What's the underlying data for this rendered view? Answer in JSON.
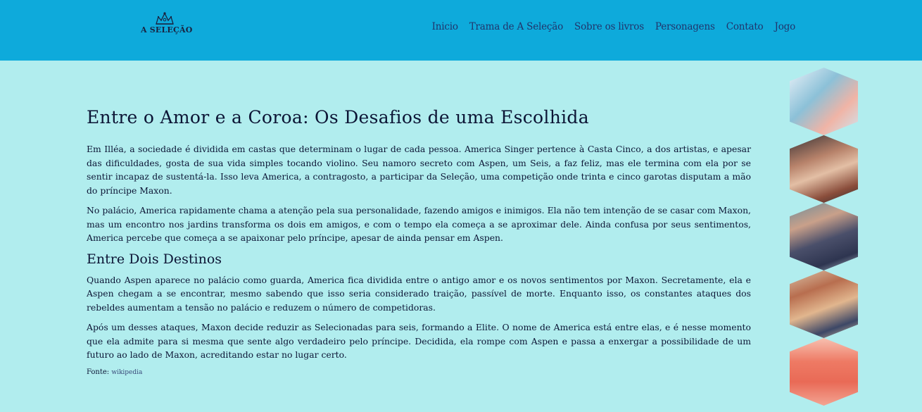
{
  "header": {
    "logo_text": "A SELEÇÃO",
    "logo_icon": "tiara-icon",
    "nav": [
      {
        "label": "Inicio"
      },
      {
        "label": "Trama de A Seleção"
      },
      {
        "label": "Sobre os livros"
      },
      {
        "label": "Personagens"
      },
      {
        "label": "Contato"
      },
      {
        "label": "Jogo"
      }
    ]
  },
  "main": {
    "title": "Entre o Amor e a Coroa: Os Desafios de uma Escolhida",
    "paragraph1": "Em Illéa, a sociedade é dividida em castas que determinam o lugar de cada pessoa. America Singer pertence à Casta Cinco, a dos artistas, e apesar das dificuldades, gosta de sua vida simples tocando violino. Seu namoro secreto com Aspen, um Seis, a faz feliz, mas ele termina com ela por se sentir incapaz de sustentá-la. Isso leva America, a contragosto, a participar da Seleção, uma competição onde trinta e cinco garotas disputam a mão do príncipe Maxon.",
    "paragraph2": "No palácio, America rapidamente chama a atenção pela sua personalidade, fazendo amigos e inimigos. Ela não tem intenção de se casar com Maxon, mas um encontro nos jardins transforma os dois em amigos, e com o tempo ela começa a se aproximar dele. Ainda confusa por seus sentimentos, America percebe que começa a se apaixonar pelo príncipe, apesar de ainda pensar em Aspen.",
    "subtitle": "Entre Dois Destinos",
    "paragraph3": "Quando Aspen aparece no palácio como guarda, America fica dividida entre o antigo amor e os novos sentimentos por Maxon. Secretamente, ela e Aspen chegam a se encontrar, mesmo sabendo que isso seria considerado traição, passível de morte. Enquanto isso, os constantes ataques dos rebeldes aumentam a tensão no palácio e reduzem o número de competidoras.",
    "paragraph4": "Após um desses ataques, Maxon decide reduzir as Selecionadas para seis, formando a Elite. O nome de America está entre elas, e é nesse momento que ela admite para si mesma que sente algo verdadeiro pelo príncipe. Decidida, ela rompe com Aspen e passa a enxergar a possibilidade de um futuro ao lado de Maxon, acreditando estar no lugar certo.",
    "source_label": "Fonte:",
    "source_link": "wikipedia"
  },
  "gallery": {
    "colors": [
      "#0eaadb",
      "#b1edee",
      "#21346b"
    ]
  }
}
